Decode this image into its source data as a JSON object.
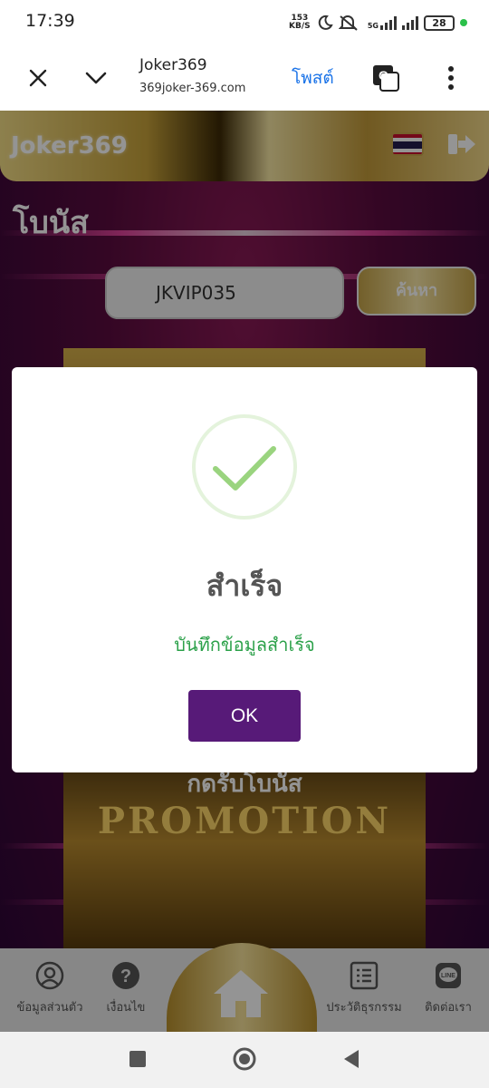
{
  "status": {
    "time": "17:39",
    "speed_value": "153",
    "speed_unit": "KB/S",
    "network": "5G",
    "battery": "28",
    "icons": [
      "moon-icon",
      "mute-icon",
      "signal-icon",
      "battery-icon"
    ]
  },
  "browser": {
    "title": "Joker369",
    "url": "369joker-369.com",
    "post_label": "โพสต์",
    "translate_icon": "G",
    "accent": "#1a73e8"
  },
  "site": {
    "logo": "Joker369",
    "page_title": "โบนัส",
    "search_value": "JKVIP035",
    "search_button": "ค้นหา",
    "promo_caption": "กดรับโบนัส",
    "promo_word": "PROMOTION"
  },
  "bottom_nav": {
    "tabs": [
      {
        "label": "ข้อมูลส่วนตัว",
        "icon": "profile-icon"
      },
      {
        "label": "เงื่อนไข",
        "icon": "help-icon"
      },
      {
        "label": "",
        "icon": "home-icon"
      },
      {
        "label": "ประวัติธุรกรรม",
        "icon": "history-icon"
      },
      {
        "label": "ติดต่อเรา",
        "icon": "line-icon"
      }
    ]
  },
  "modal": {
    "title": "สำเร็จ",
    "message": "บันทึกข้อมูลสำเร็จ",
    "ok_label": "OK",
    "button_color": "#571a78",
    "message_color": "#2ca14a",
    "check_color": "#9ad47f"
  }
}
